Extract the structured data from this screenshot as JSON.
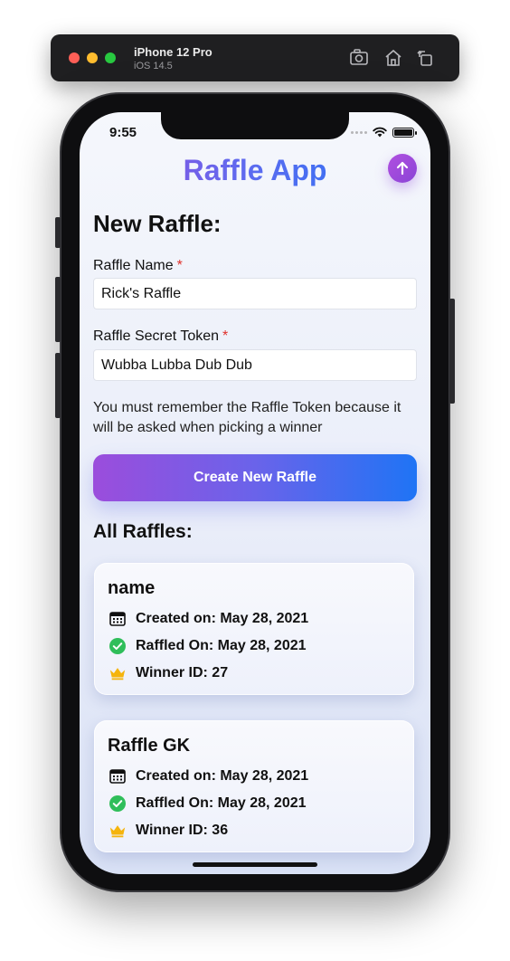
{
  "simulator": {
    "device_name": "iPhone 12 Pro",
    "os_version": "iOS 14.5",
    "icons": [
      "screenshot-icon",
      "home-icon",
      "rotate-icon"
    ]
  },
  "status_bar": {
    "time": "9:55"
  },
  "app": {
    "title": "Raffle App",
    "upload_icon": "arrow-up-icon"
  },
  "new_raffle": {
    "heading": "New Raffle:",
    "name_label": "Raffle Name",
    "name_value": "Rick's Raffle",
    "token_label": "Raffle Secret Token",
    "token_value": "Wubba Lubba Dub Dub",
    "required_mark": "*",
    "hint": "You must remember the Raffle Token because it will be asked when picking a winner",
    "create_button": "Create New Raffle"
  },
  "all_raffles": {
    "heading": "All Raffles:",
    "items": [
      {
        "name": "name",
        "created": "Created on: May 28, 2021",
        "raffled": "Raffled On: May 28, 2021",
        "winner": "Winner ID: 27"
      },
      {
        "name": "Raffle GK",
        "created": "Created on: May 28, 2021",
        "raffled": "Raffled On: May 28, 2021",
        "winner": "Winner ID: 36"
      }
    ]
  },
  "colors": {
    "gradient_start": "#9b4ddc",
    "gradient_end": "#1f74f5",
    "required": "#e0302a",
    "check_green": "#2fbe5a",
    "crown_yellow": "#f5b40c"
  }
}
